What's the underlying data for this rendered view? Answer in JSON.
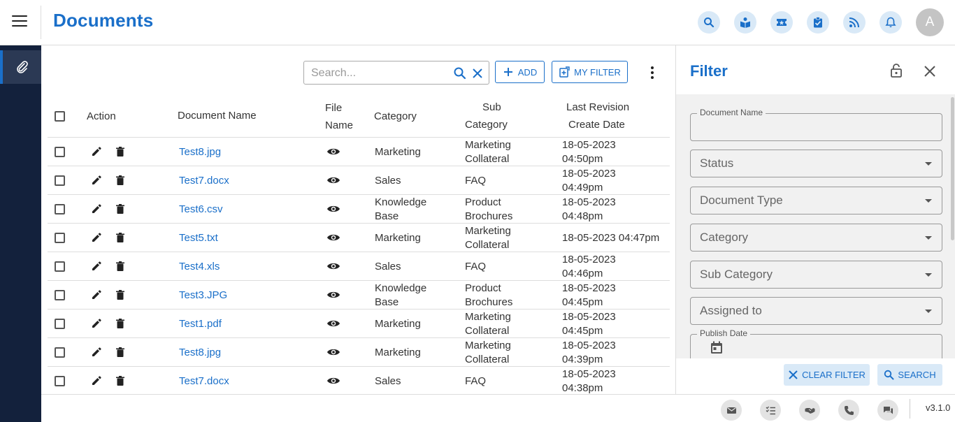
{
  "header": {
    "title": "Documents",
    "avatar_initial": "A",
    "icons": [
      "search-icon",
      "book-reader-icon",
      "ticket-icon",
      "clipboard-check-icon",
      "rss-icon",
      "bell-icon"
    ]
  },
  "sidebar": {
    "items": [
      {
        "icon": "paperclip-icon"
      }
    ]
  },
  "toolbar": {
    "search_placeholder": "Search...",
    "add_label": "ADD",
    "my_filter_label": "MY FILTER"
  },
  "table": {
    "headers": {
      "action": "Action",
      "document_name": "Document Name",
      "file_name_1": "File",
      "file_name_2": "Name",
      "category": "Category",
      "sub_category_1": "Sub",
      "sub_category_2": "Category",
      "last_revision_1": "Last Revision",
      "last_revision_2": "Create Date"
    },
    "rows": [
      {
        "name": "Test8.jpg",
        "cat1": "Marketing",
        "cat2": "",
        "sub1": "Marketing",
        "sub2": "Collateral",
        "date1": "18-05-2023",
        "date2": "04:50pm"
      },
      {
        "name": "Test7.docx",
        "cat1": "Sales",
        "cat2": "",
        "sub1": "FAQ",
        "sub2": "",
        "date1": "18-05-2023",
        "date2": "04:49pm"
      },
      {
        "name": "Test6.csv",
        "cat1": "Knowledge",
        "cat2": "Base",
        "sub1": "Product",
        "sub2": "Brochures",
        "date1": "18-05-2023",
        "date2": "04:48pm"
      },
      {
        "name": "Test5.txt",
        "cat1": "Marketing",
        "cat2": "",
        "sub1": "Marketing",
        "sub2": "Collateral",
        "date1": "18-05-2023 04:47pm",
        "date2": ""
      },
      {
        "name": "Test4.xls",
        "cat1": "Sales",
        "cat2": "",
        "sub1": "FAQ",
        "sub2": "",
        "date1": "18-05-2023",
        "date2": "04:46pm"
      },
      {
        "name": "Test3.JPG",
        "cat1": "Knowledge",
        "cat2": "Base",
        "sub1": "Product",
        "sub2": "Brochures",
        "date1": "18-05-2023",
        "date2": "04:45pm"
      },
      {
        "name": "Test1.pdf",
        "cat1": "Marketing",
        "cat2": "",
        "sub1": "Marketing",
        "sub2": "Collateral",
        "date1": "18-05-2023",
        "date2": "04:45pm"
      },
      {
        "name": "Test8.jpg",
        "cat1": "Marketing",
        "cat2": "",
        "sub1": "Marketing",
        "sub2": "Collateral",
        "date1": "18-05-2023",
        "date2": "04:39pm"
      },
      {
        "name": "Test7.docx",
        "cat1": "Sales",
        "cat2": "",
        "sub1": "FAQ",
        "sub2": "",
        "date1": "18-05-2023",
        "date2": "04:38pm"
      }
    ]
  },
  "filter": {
    "title": "Filter",
    "document_name_label": "Document Name",
    "document_name_value": "",
    "status_label": "Status",
    "document_type_label": "Document Type",
    "category_label": "Category",
    "sub_category_label": "Sub Category",
    "assigned_to_label": "Assigned to",
    "publish_date_label": "Publish Date",
    "clear_label": "CLEAR FILTER",
    "search_label": "SEARCH"
  },
  "footer": {
    "version": "v3.1.0",
    "icons": [
      "mail-icon",
      "checklist-icon",
      "handshake-icon",
      "phone-icon",
      "chat-icon"
    ]
  },
  "colors": {
    "accent": "#1a6fc9",
    "sidebar": "#13213c",
    "icon_bg": "#d9e9f7"
  }
}
